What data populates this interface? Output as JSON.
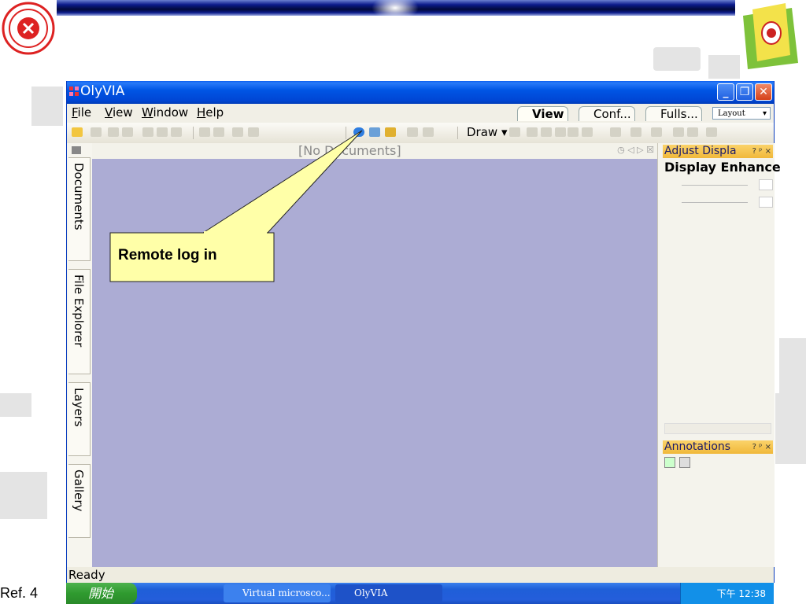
{
  "slide": {
    "ref_label": "Ref. 4"
  },
  "window": {
    "title": "OlyVIA",
    "menu": [
      {
        "label": "File",
        "mnemonic": "F",
        "rest": "ile"
      },
      {
        "label": "View",
        "mnemonic": "V",
        "rest": "iew"
      },
      {
        "label": "Window",
        "mnemonic": "W",
        "rest": "indow"
      },
      {
        "label": "Help",
        "mnemonic": "H",
        "rest": "elp"
      }
    ],
    "view_tabs": [
      {
        "label": "View",
        "active": true
      },
      {
        "label": "Conf...",
        "active": false
      },
      {
        "label": "Fulls...",
        "active": false
      }
    ],
    "layout_select": "Layout",
    "draw_button": "Draw",
    "document_header": "[No Documents]",
    "side_tabs": [
      "Documents",
      "File Explorer",
      "Layers",
      "Gallery"
    ],
    "panels": {
      "adjust_title": "Adjust Displa",
      "adjust_controls": "? ᵖ ×",
      "display_enhance": "Display Enhance",
      "annotations_title": "Annotations",
      "annotations_controls": "? ᵖ ×"
    },
    "status": "Ready"
  },
  "callout": {
    "text": "Remote log in",
    "fill": "#ffffa8"
  },
  "taskbar": {
    "start_label": "開始",
    "tasks": [
      "Virtual microsco...",
      "OlyVIA"
    ],
    "clock": "下午 12:38"
  },
  "colors": {
    "document_bg": "#acacd4",
    "titlebar": "#0055e5",
    "panel_header": "#f0b83a"
  }
}
